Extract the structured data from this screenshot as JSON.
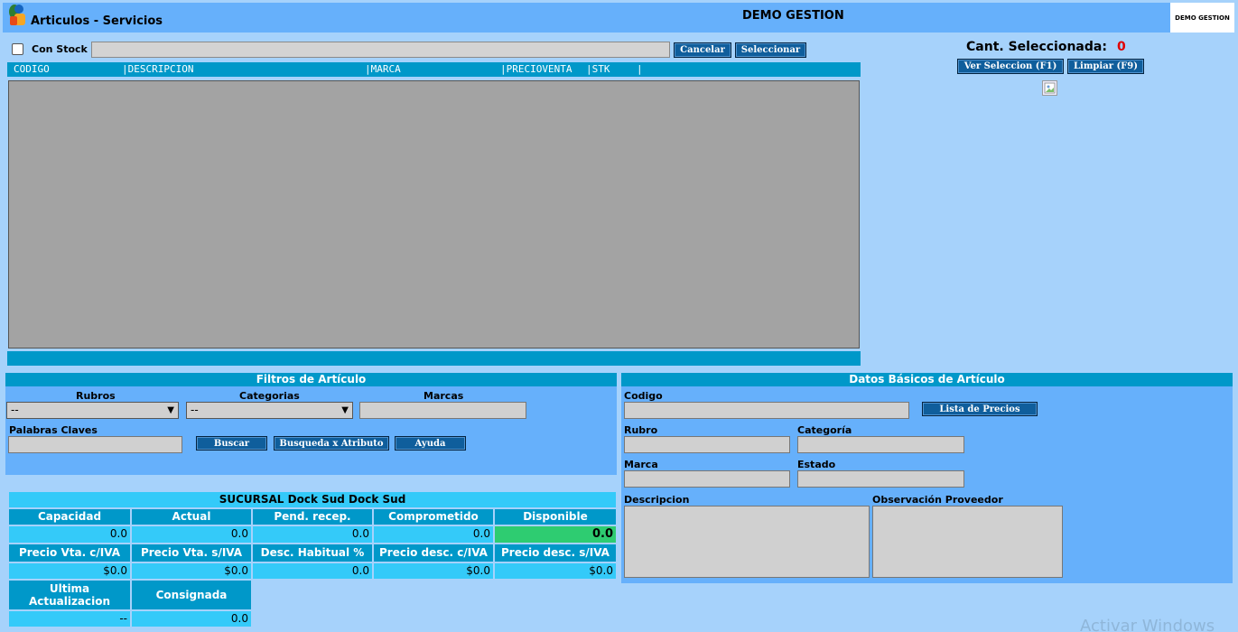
{
  "header": {
    "window_title": "Articulos - Servicios",
    "company_title": "DEMO GESTION",
    "logo_text": "DEMO GESTION"
  },
  "search": {
    "stock_label": "Con Stock",
    "value": "",
    "cancel_label": "Cancelar",
    "select_label": "Seleccionar"
  },
  "list": {
    "columns": [
      "CODIGO",
      "|DESCRIPCION",
      "|MARCA",
      "|PRECIOVENTA",
      "|STK",
      "|"
    ]
  },
  "selection": {
    "count_label": "Cant. Seleccionada:",
    "count_value": "0",
    "view_label": "Ver Seleccion (F1)",
    "clear_label": "Limpiar (F9)"
  },
  "filters": {
    "title": "Filtros de Artículo",
    "rubros_label": "Rubros",
    "rubros_value": "--",
    "categorias_label": "Categorias",
    "categorias_value": "--",
    "marcas_label": "Marcas",
    "keywords_label": "Palabras Claves",
    "search_label": "Buscar",
    "attr_label": "Busqueda x Atributo",
    "help_label": "Ayuda"
  },
  "article": {
    "title": "Datos Básicos  de  Artículo",
    "codigo_label": "Codigo",
    "price_list_label": "Lista de Precios",
    "rubro_label": "Rubro",
    "categoria_label": "Categoría",
    "marca_label": "Marca",
    "estado_label": "Estado",
    "descripcion_label": "Descripcion",
    "obs_label": "Observación Proveedor"
  },
  "stock": {
    "title": "SUCURSAL Dock Sud Dock Sud",
    "row1_headers": [
      "Capacidad",
      "Actual",
      "Pend. recep.",
      "Comprometido",
      "Disponible"
    ],
    "row1_values": [
      "0.0",
      "0.0",
      "0.0",
      "0.0",
      "0.0"
    ],
    "row2_headers": [
      "Precio Vta. c/IVA",
      "Precio Vta. s/IVA",
      "Desc. Habitual %",
      "Precio desc. c/IVA",
      "Precio desc. s/IVA"
    ],
    "row2_values": [
      "$0.0",
      "$0.0",
      "0.0",
      "$0.0",
      "$0.0"
    ],
    "row3_headers": [
      "Ultima Actualizacion",
      "Consignada"
    ],
    "row3_values": [
      "--",
      "0.0"
    ]
  },
  "watermark": "Activar Windows",
  "colors": {
    "background": "#a6d2fb",
    "header": "#66b0fb",
    "accent": "#0098c9",
    "button": "#0f5e9c",
    "cell": "#34caf9",
    "available": "#2ecc71",
    "count": "#e00000"
  }
}
